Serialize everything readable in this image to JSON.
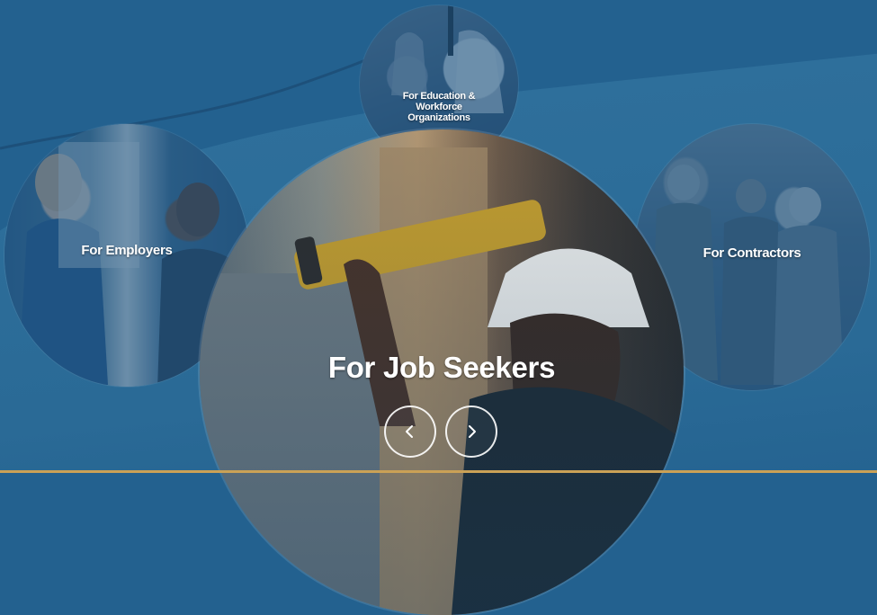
{
  "audiences": {
    "education": {
      "label": "For Education & Workforce Organizations"
    },
    "employers": {
      "label": "For Employers"
    },
    "contractors": {
      "label": "For Contractors"
    },
    "job_seekers": {
      "label": "For Job Seekers"
    }
  },
  "carousel": {
    "prev_icon": "chevron-left-icon",
    "next_icon": "chevron-right-icon"
  },
  "colors": {
    "background": "#23618f",
    "text": "#ffffff",
    "accent_bar": "#caa156"
  }
}
